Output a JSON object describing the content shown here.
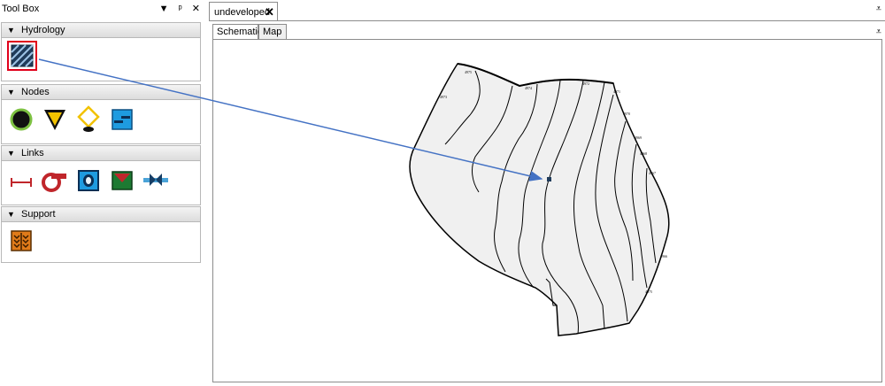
{
  "toolbox": {
    "title": "Tool Box",
    "dropdown_glyph": "▼",
    "pin_glyph": "🖈",
    "close_glyph": "✕",
    "sections": {
      "hydrology": {
        "label": "Hydrology",
        "tools": [
          "subbasin-icon"
        ]
      },
      "nodes": {
        "label": "Nodes",
        "tools": [
          "junction-icon",
          "outfall-icon",
          "divider-icon",
          "storage-icon"
        ]
      },
      "links": {
        "label": "Links",
        "tools": [
          "conduit-icon",
          "pump-icon",
          "orifice-icon",
          "weir-icon",
          "outlet-icon"
        ]
      },
      "support": {
        "label": "Support",
        "tools": [
          "rain-gage-icon"
        ]
      }
    },
    "collapse_glyph": "▼"
  },
  "document": {
    "tab_label": "undeveloped",
    "tab_close": "✕",
    "menu_glyph": "₹",
    "subtabs": [
      "Schematic",
      "Map"
    ],
    "active_subtab": "Schematic"
  },
  "map": {
    "contour_labels": [
      "4975",
      "4974",
      "4973",
      "4972",
      "4971",
      "4970",
      "4969",
      "4968",
      "4967",
      "4966"
    ]
  },
  "colors": {
    "highlight": "#e0001b",
    "arrow": "#4472c4",
    "map_fill": "#f0f0f0"
  }
}
